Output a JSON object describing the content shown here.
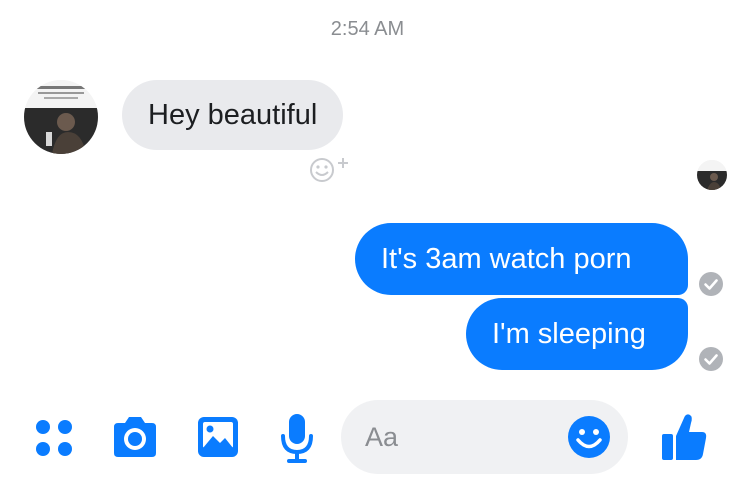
{
  "conversation": {
    "timestamp": "2:54 AM",
    "messages": [
      {
        "direction": "incoming",
        "text": "Hey beautiful"
      },
      {
        "direction": "outgoing",
        "text": "It's 3am watch porn",
        "status": "delivered"
      },
      {
        "direction": "outgoing",
        "text": "I'm sleeping",
        "status": "delivered"
      }
    ]
  },
  "composer": {
    "placeholder": "Aa",
    "tools": [
      "more-apps-icon",
      "camera-icon",
      "gallery-icon",
      "microphone-icon"
    ],
    "emoji_icon": "smiley-icon",
    "send_icon": "thumbs-up-icon"
  },
  "colors": {
    "accent": "#0a7cff",
    "incoming_bubble": "#e9eaed",
    "timestamp_text": "#8a8d91",
    "input_bg": "#f0f1f3"
  }
}
